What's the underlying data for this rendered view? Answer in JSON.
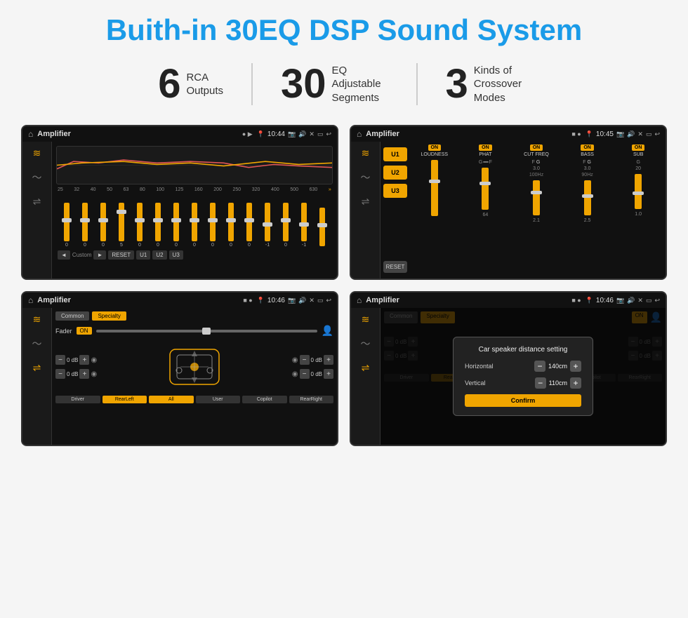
{
  "page": {
    "title": "Buith-in 30EQ DSP Sound System",
    "stats": [
      {
        "number": "6",
        "text": "RCA\nOutputs"
      },
      {
        "number": "30",
        "text": "EQ Adjustable\nSegments"
      },
      {
        "number": "3",
        "text": "Kinds of\nCrossover Modes"
      }
    ]
  },
  "screens": [
    {
      "id": "eq-screen",
      "title": "Amplifier",
      "time": "10:44",
      "type": "eq",
      "eq_bands": [
        "25",
        "32",
        "40",
        "50",
        "63",
        "80",
        "100",
        "125",
        "160",
        "200",
        "250",
        "320",
        "400",
        "500",
        "630"
      ],
      "eq_values": [
        "0",
        "0",
        "0",
        "5",
        "0",
        "0",
        "0",
        "0",
        "0",
        "0",
        "0",
        "-1",
        "0",
        "-1",
        ""
      ],
      "eq_preset": "Custom",
      "buttons": [
        "◄",
        "Custom",
        "►",
        "RESET",
        "U1",
        "U2",
        "U3"
      ]
    },
    {
      "id": "amp-screen",
      "title": "Amplifier",
      "time": "10:45",
      "type": "amp",
      "channels": [
        "LOUDNESS",
        "PHAT",
        "CUT FREQ",
        "BASS",
        "SUB"
      ],
      "u_buttons": [
        "U1",
        "U2",
        "U3"
      ],
      "reset_label": "RESET"
    },
    {
      "id": "crossover-screen",
      "title": "Amplifier",
      "time": "10:46",
      "type": "crossover",
      "tabs": [
        "Common",
        "Specialty"
      ],
      "fader_label": "Fader",
      "fader_on": "ON",
      "db_values": [
        "0 dB",
        "0 dB",
        "0 dB",
        "0 dB"
      ],
      "buttons": [
        "Driver",
        "RearLeft",
        "All",
        "User",
        "Copilot",
        "RearRight"
      ]
    },
    {
      "id": "distance-screen",
      "title": "Amplifier",
      "time": "10:46",
      "type": "distance",
      "tabs": [
        "Common",
        "Specialty"
      ],
      "dialog": {
        "title": "Car speaker distance setting",
        "horizontal_label": "Horizontal",
        "horizontal_value": "140cm",
        "vertical_label": "Vertical",
        "vertical_value": "110cm",
        "confirm_label": "Confirm"
      },
      "db_values": [
        "0 dB",
        "0 dB"
      ],
      "right_buttons": [
        "Driver",
        "RearLeft",
        "All",
        "User",
        "Copilot",
        "RearRight"
      ]
    }
  ],
  "icons": {
    "home": "⌂",
    "back": "↩",
    "location": "📍",
    "volume": "🔊",
    "close": "✕",
    "minimize": "▭",
    "camera": "📷",
    "eq_filter": "≋",
    "wave": "〜",
    "balance": "⇌",
    "settings": "⚙",
    "person": "👤"
  }
}
